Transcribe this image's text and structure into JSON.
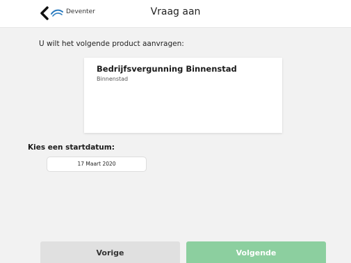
{
  "header": {
    "brand": "Deventer",
    "title": "Vraag aan",
    "back_icon": "chevron-left-icon",
    "logo_icon": "deventer-logo-icon"
  },
  "main": {
    "intro": "U wilt het volgende product aanvragen:",
    "product": {
      "name": "Bedrijfsvergunning Binnenstad",
      "subtitle": "Binnenstad"
    },
    "start_label": "Kies een startdatum:",
    "start_date": "17 Maart 2020"
  },
  "footer": {
    "prev_label": "Vorige",
    "next_label": "Volgende"
  },
  "colors": {
    "background": "#f2f2f2",
    "next_button": "#8ccf9f",
    "prev_button": "#e0e0e0"
  }
}
